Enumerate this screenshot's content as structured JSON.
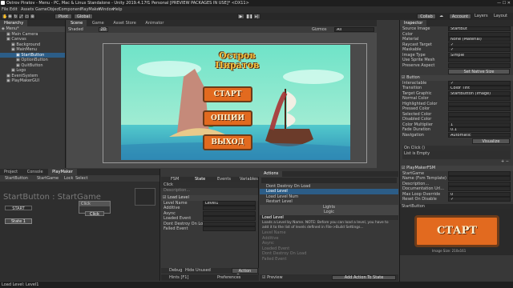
{
  "window": {
    "title": "Ostrov Piratov - Menu - PC, Mac & Linux Standalone - Unity 2019.4.17f1 Personal [PREVIEW PACKAGES IN USE]* <DX11>",
    "menus": [
      "File",
      "Edit",
      "Assets",
      "GameObject",
      "Component",
      "PlayMaker",
      "Window",
      "Help"
    ]
  },
  "toolbar": {
    "pivot": "Pivot",
    "global": "Global",
    "collab": "Collab",
    "account": "Account",
    "layers": "Layers",
    "layout": "Layout"
  },
  "hierarchy": {
    "tab": "Hierarchy",
    "scene": "Menu*",
    "items": [
      {
        "label": "Main Camera",
        "indent": 1,
        "selected": false
      },
      {
        "label": "Canvas",
        "indent": 1,
        "selected": false
      },
      {
        "label": "Background",
        "indent": 2,
        "selected": false
      },
      {
        "label": "MainMenu",
        "indent": 2,
        "selected": false
      },
      {
        "label": "StartButton",
        "indent": 3,
        "selected": true
      },
      {
        "label": "OptionButton",
        "indent": 3,
        "selected": false
      },
      {
        "label": "QuitButton",
        "indent": 3,
        "selected": false
      },
      {
        "label": "Logo",
        "indent": 2,
        "selected": false
      },
      {
        "label": "EventSystem",
        "indent": 1,
        "selected": false
      },
      {
        "label": "PlayMakerGUI",
        "indent": 1,
        "selected": false
      }
    ]
  },
  "scene_tabs": {
    "scene": "Scene",
    "game": "Game",
    "asset_store": "Asset Store",
    "animator": "Animator"
  },
  "scene_toolbar": {
    "shaded": "Shaded",
    "twod": "2D",
    "gizmos": "Gizmos",
    "search": "All"
  },
  "game_view": {
    "title_line1": "Остров",
    "title_line2": "Пиратов",
    "btn_start": "СТАРТ",
    "btn_options": "ОПЦИИ",
    "btn_exit": "ВЫХОД"
  },
  "inspector": {
    "tab": "Inspector",
    "image_rows": [
      {
        "label": "Source Image",
        "value": "StartBut"
      },
      {
        "label": "Color",
        "value": ""
      },
      {
        "label": "Material",
        "value": "None (Material)"
      },
      {
        "label": "Raycast Target",
        "value": "✓"
      },
      {
        "label": "Maskable",
        "value": "✓"
      },
      {
        "label": "Image Type",
        "value": "Simple"
      },
      {
        "label": "Use Sprite Mesh",
        "value": ""
      },
      {
        "label": "Preserve Aspect",
        "value": ""
      }
    ],
    "set_native_size": "Set Native Size",
    "button_component": "Button",
    "button_rows": [
      {
        "label": "Interactable",
        "value": "✓"
      },
      {
        "label": "Transition",
        "value": "Color Tint"
      },
      {
        "label": "Target Graphic",
        "value": "StartButton (Image)"
      },
      {
        "label": "Normal Color",
        "value": ""
      },
      {
        "label": "Highlighted Color",
        "value": ""
      },
      {
        "label": "Pressed Color",
        "value": ""
      },
      {
        "label": "Selected Color",
        "value": ""
      },
      {
        "label": "Disabled Color",
        "value": ""
      },
      {
        "label": "Color Multiplier",
        "value": "1"
      },
      {
        "label": "Fade Duration",
        "value": "0.1"
      }
    ],
    "navigation_label": "Navigation",
    "navigation_value": "Automatic",
    "visualize": "Visualize",
    "on_click": "On Click ()",
    "list_empty": "List is Empty",
    "fsm_component": "PlayMakerFSM",
    "fsm_rows": [
      {
        "label": "StartGame",
        "value": ""
      },
      {
        "label": "Name (Fsm Template)",
        "value": ""
      },
      {
        "label": "Description...",
        "value": ""
      },
      {
        "label": "Documentation Url...",
        "value": ""
      },
      {
        "label": "Max Loop Override",
        "value": "0"
      },
      {
        "label": "Reset On Disable",
        "value": "✓"
      }
    ],
    "preview_label": "StartButton",
    "preview_text": "СТАРТ",
    "preview_caption": "Image Size: 210x161"
  },
  "bottom_left": {
    "tabs": [
      "Project",
      "Console",
      "PlayMaker"
    ],
    "toolbar": [
      "StartButton",
      "StartGame",
      "Lock",
      "Select"
    ],
    "graph_title": "StartButton : StartGame",
    "states": [
      {
        "label": "START",
        "kind": "start"
      },
      {
        "label": "State 1",
        "kind": "state"
      }
    ],
    "events": [
      "Click",
      "Click"
    ]
  },
  "fsm_panel": {
    "tabs": [
      "FSM",
      "State",
      "Events",
      "Variables"
    ],
    "state_name": "Click",
    "description": "Description...",
    "action_title": "Load Level",
    "rows": [
      {
        "label": "Level Name",
        "value": "Level1"
      },
      {
        "label": "Additive",
        "value": ""
      },
      {
        "label": "Async",
        "value": ""
      },
      {
        "label": "Loaded Event",
        "value": ""
      },
      {
        "label": "Dont Destroy On Load",
        "value": ""
      },
      {
        "label": "Failed Event",
        "value": ""
      }
    ],
    "debug": "Debug",
    "hide_unused": "Hide Unused",
    "action_browser": "Action Browser",
    "hints": "Hints [F1]",
    "preferences": "Preferences"
  },
  "actions_panel": {
    "tab": "Actions",
    "items": [
      {
        "label": "Dont Destroy On Load",
        "selected": false
      },
      {
        "label": "Load Level",
        "selected": true
      },
      {
        "label": "Load Level Num",
        "selected": false
      },
      {
        "label": "Restart Level",
        "selected": false
      }
    ],
    "lights": "Lights",
    "logic": "Logic",
    "desc_title": "Load Level",
    "desc": "Loads a Level by Name. NOTE: Before you can load a level, you have to add it to the list of levels defined in File->Build Settings...",
    "preview_rows": [
      "Level Name",
      "Additive",
      "Async",
      "Loaded Event",
      "Dont Destroy On Load",
      "Failed Event"
    ],
    "preview": "Preview",
    "add_button": "Add Action To State"
  },
  "status": {
    "text": "Load Level: Level1"
  },
  "colors": {
    "selection": "#2c5d87",
    "button_orange": "#e26a1f",
    "sea": "#4fc6c9",
    "sky": "#7fe0c9"
  }
}
